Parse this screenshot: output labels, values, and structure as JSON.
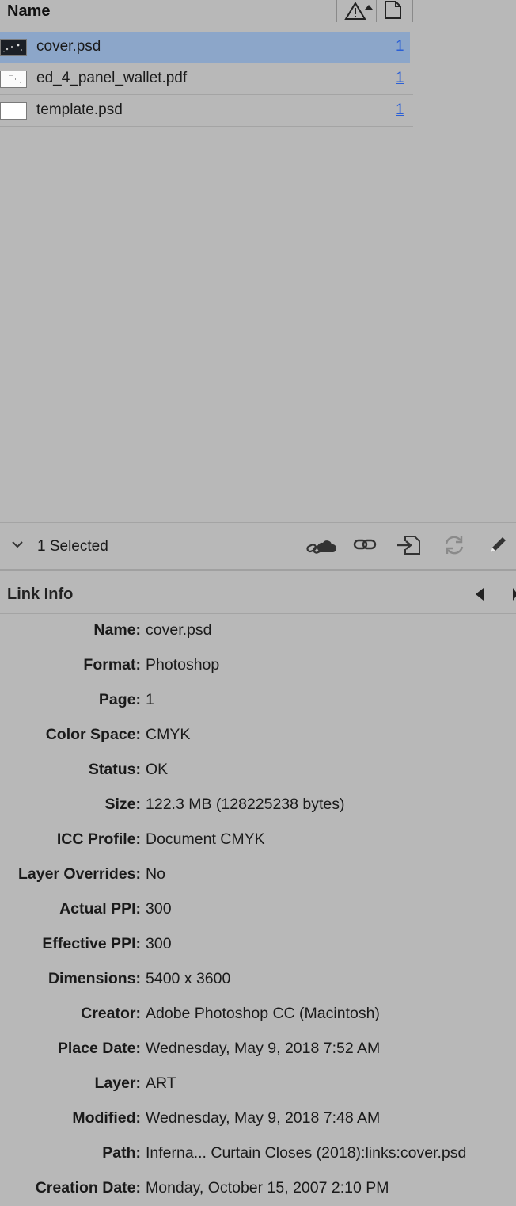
{
  "header": {
    "name_column": "Name",
    "status_column_icon": "warning-sort-icon",
    "page_column_icon": "page-icon"
  },
  "links": [
    {
      "name": "cover.psd",
      "page": "1",
      "selected": true,
      "thumb": "dark-image"
    },
    {
      "name": "ed_4_panel_wallet.pdf",
      "page": "1",
      "selected": false,
      "thumb": "document"
    },
    {
      "name": "template.psd",
      "page": "1",
      "selected": false,
      "thumb": "blank"
    }
  ],
  "toolbar": {
    "selection_label": "1 Selected",
    "icons": [
      "chevron-down-icon",
      "cloud-link-icon",
      "relink-icon",
      "goto-link-icon",
      "update-link-icon",
      "edit-original-icon"
    ]
  },
  "link_info": {
    "title": "Link Info",
    "fields": [
      {
        "label": "Name:",
        "value": "cover.psd"
      },
      {
        "label": "Format:",
        "value": "Photoshop"
      },
      {
        "label": "Page:",
        "value": "1"
      },
      {
        "label": "Color Space:",
        "value": "CMYK"
      },
      {
        "label": "Status:",
        "value": "OK"
      },
      {
        "label": "Size:",
        "value": "122.3 MB (128225238 bytes)"
      },
      {
        "label": "ICC Profile:",
        "value": "Document CMYK"
      },
      {
        "label": "Layer Overrides:",
        "value": "No"
      },
      {
        "label": "Actual PPI:",
        "value": "300"
      },
      {
        "label": "Effective PPI:",
        "value": "300"
      },
      {
        "label": "Dimensions:",
        "value": "5400 x 3600"
      },
      {
        "label": "Creator:",
        "value": "Adobe Photoshop CC (Macintosh)"
      },
      {
        "label": "Place Date:",
        "value": "Wednesday, May 9, 2018 7:52 AM"
      },
      {
        "label": "Layer:",
        "value": "ART"
      },
      {
        "label": "Modified:",
        "value": "Wednesday, May 9, 2018 7:48 AM"
      },
      {
        "label": "Path:",
        "value": "Inferna... Curtain Closes (2018):links:cover.psd"
      },
      {
        "label": "Creation Date:",
        "value": "Monday, October 15, 2007 2:10 PM"
      }
    ]
  },
  "colors": {
    "panel_bg": "#b8b8b8",
    "selection": "#8ca6c9",
    "link": "#2a5fd6"
  }
}
